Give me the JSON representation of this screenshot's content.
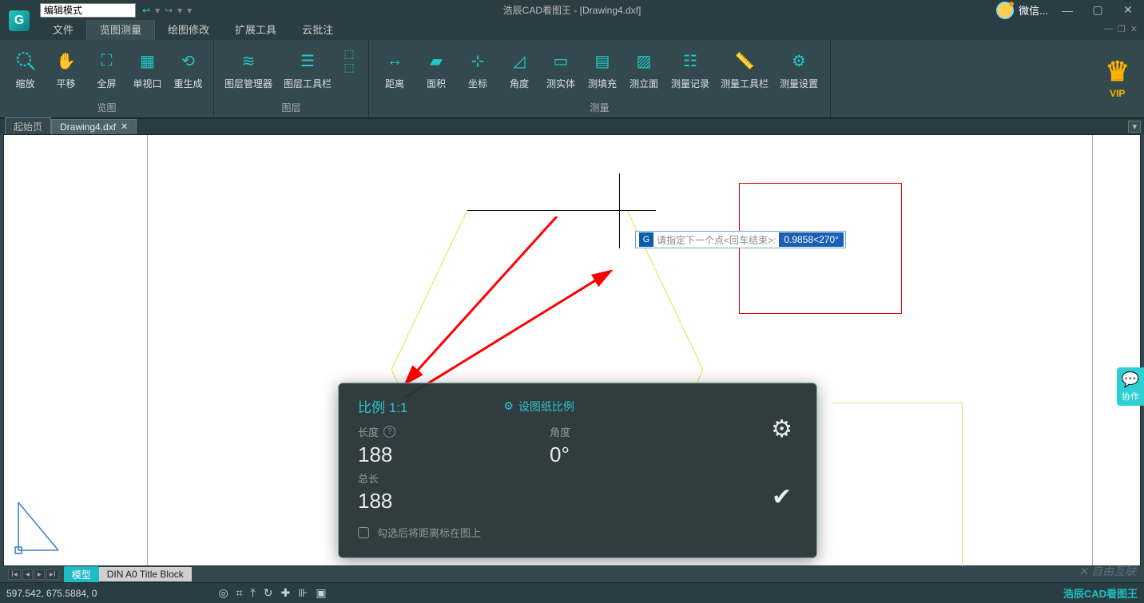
{
  "title": "浩辰CAD看图王 - [Drawing4.dxf]",
  "mode": "编辑模式",
  "wechat": "微信...",
  "menu": {
    "file": "文件",
    "view_measure": "览图测量",
    "edit": "绘图修改",
    "ext": "扩展工具",
    "cloud": "云批注"
  },
  "ribbon": {
    "view_group": "览图",
    "layer_group": "图层",
    "measure_group": "测量",
    "zoom": "缩放",
    "pan": "平移",
    "full": "全屏",
    "single_vp": "单视口",
    "regen": "重生成",
    "layer_mgr": "图层管理器",
    "layer_tb": "图层工具栏",
    "distance": "距离",
    "area": "面积",
    "coord": "坐标",
    "angle": "角度",
    "solid": "测实体",
    "fill": "测填充",
    "section": "测立面",
    "record": "测量记录",
    "meas_tb": "测量工具栏",
    "meas_set": "测量设置",
    "vip": "VIP"
  },
  "tabs": {
    "start": "起始页",
    "doc": "Drawing4.dxf"
  },
  "cmd": {
    "prompt": "请指定下一个点<回车结束>:",
    "value": "0.9858<270°"
  },
  "panel": {
    "scale": "比例 1:1",
    "set_scale": "设图纸比例",
    "length_label": "长度",
    "length_value": "188",
    "angle_label": "角度",
    "angle_value": "0°",
    "total_label": "总长",
    "total_value": "188",
    "checkbox_label": "勾选后将距离标在图上"
  },
  "layout": {
    "model": "模型",
    "sheet": "DIN A0 Title Block"
  },
  "status": {
    "coords": "597.542, 675.5884, 0",
    "brand": "浩辰CAD看图王"
  },
  "collab": "协作",
  "watermark": "自由互联"
}
